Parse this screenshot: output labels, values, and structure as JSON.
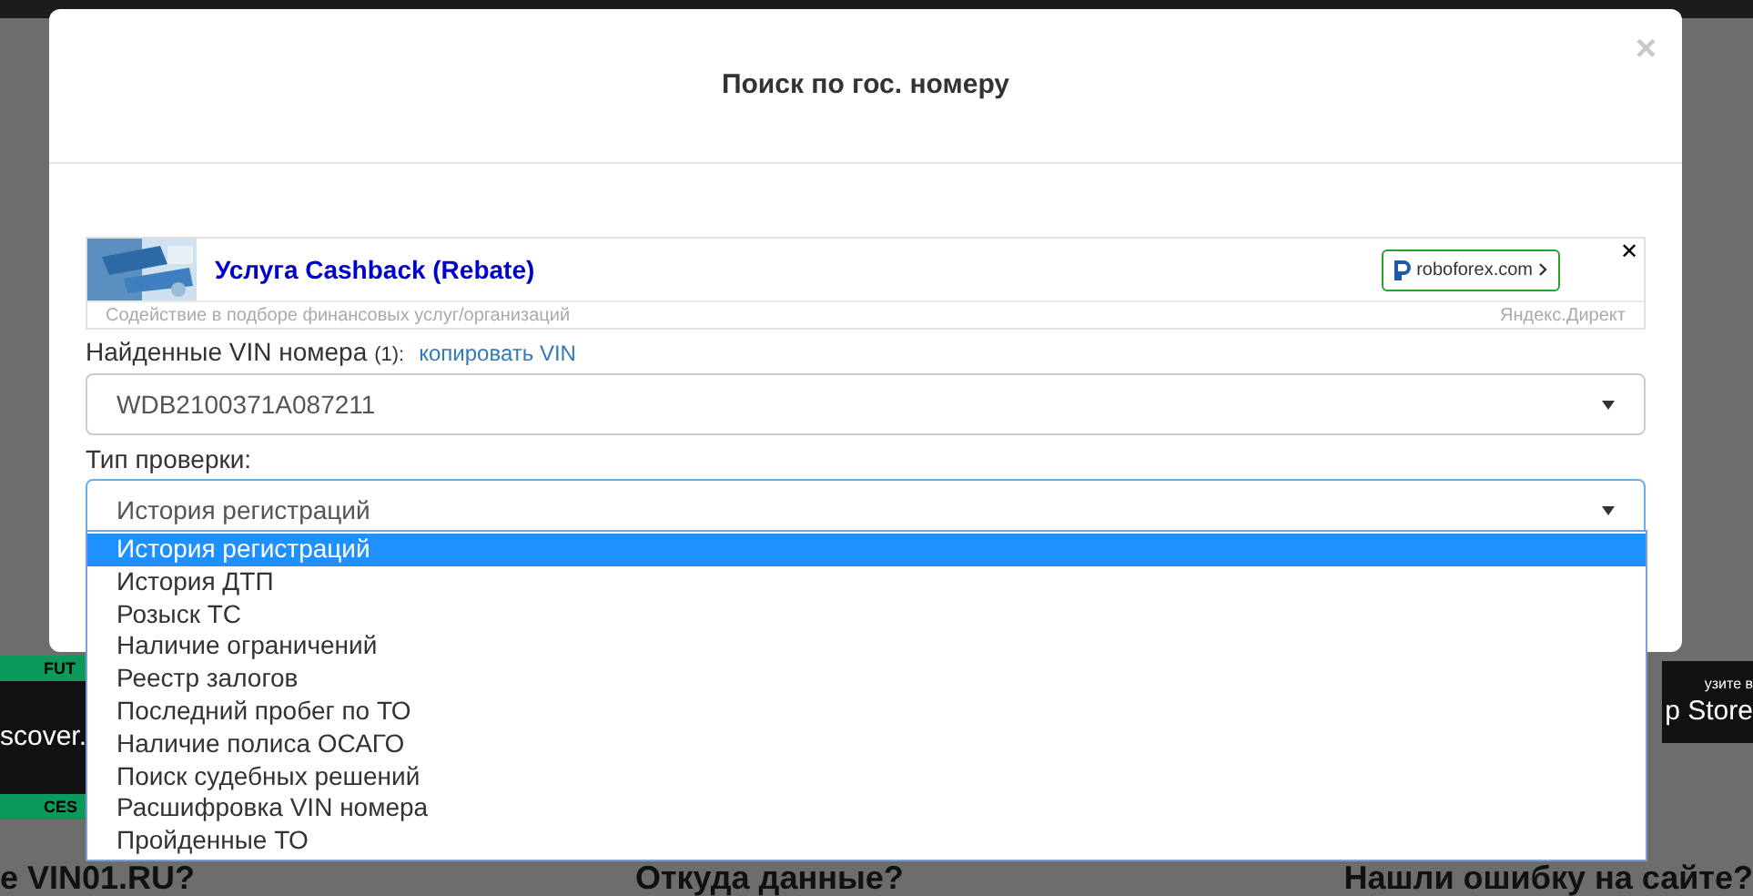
{
  "modal": {
    "title": "Поиск по гос. номеру",
    "close": "×"
  },
  "ad": {
    "title": "Услуга Cashback (Rebate)",
    "domain": "roboforex.com",
    "description": "Содействие в подборе финансовых услуг/организаций",
    "source": "Яндекс.Директ",
    "close": "✕"
  },
  "vin": {
    "label": "Найденные VIN номера",
    "count": "(1):",
    "copy_link": "копировать VIN",
    "value": "WDB2100371A087211"
  },
  "check_type": {
    "label": "Тип проверки:",
    "value": "История регистраций",
    "expanded": true
  },
  "options": [
    {
      "label": "История регистраций",
      "selected": true
    },
    {
      "label": "История ДТП",
      "selected": false
    },
    {
      "label": "Розыск ТС",
      "selected": false
    },
    {
      "label": "Наличие ограничений",
      "selected": false
    },
    {
      "label": "Реестр залогов",
      "selected": false
    },
    {
      "label": "Последний пробег по ТО",
      "selected": false
    },
    {
      "label": "Наличие полиса ОСАГО",
      "selected": false
    },
    {
      "label": "Поиск судебных решений",
      "selected": false
    },
    {
      "label": "Расшифровка VIN номера",
      "selected": false
    },
    {
      "label": "Пройденные ТО",
      "selected": false
    }
  ],
  "background": {
    "left_banner": [
      "FUT",
      "scover.",
      "CES"
    ],
    "right_banner": [
      "узите в",
      "p Store"
    ],
    "headings": [
      "е VIN01.RU?",
      "Откуда данные?",
      "Нашли ошибку на сайте?"
    ]
  }
}
